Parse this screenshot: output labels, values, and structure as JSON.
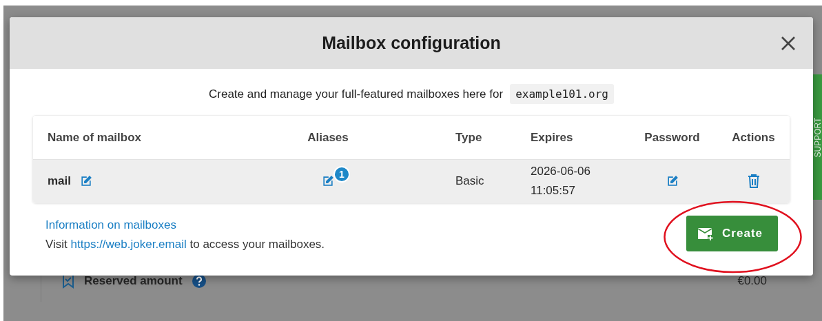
{
  "dialog": {
    "title": "Mailbox configuration",
    "intro": "Create and manage your full-featured mailboxes here for",
    "domain": "example101.org",
    "table": {
      "columns": [
        "Name of mailbox",
        "Aliases",
        "Type",
        "Expires",
        "Password",
        "Actions"
      ],
      "rows": [
        {
          "name": "mail",
          "alias_count": "1",
          "type": "Basic",
          "expires": [
            "2026-06-06",
            "11:05:57"
          ]
        }
      ]
    },
    "info_link": "Information on mailboxes",
    "visit": {
      "before": "Visit",
      "link": "https://web.joker.email",
      "after": "to access your mailboxes."
    },
    "create_button": "Create"
  },
  "background": {
    "label": "Reserved amount",
    "amount": "€0.00"
  },
  "support_tab": "SUPPORT"
}
